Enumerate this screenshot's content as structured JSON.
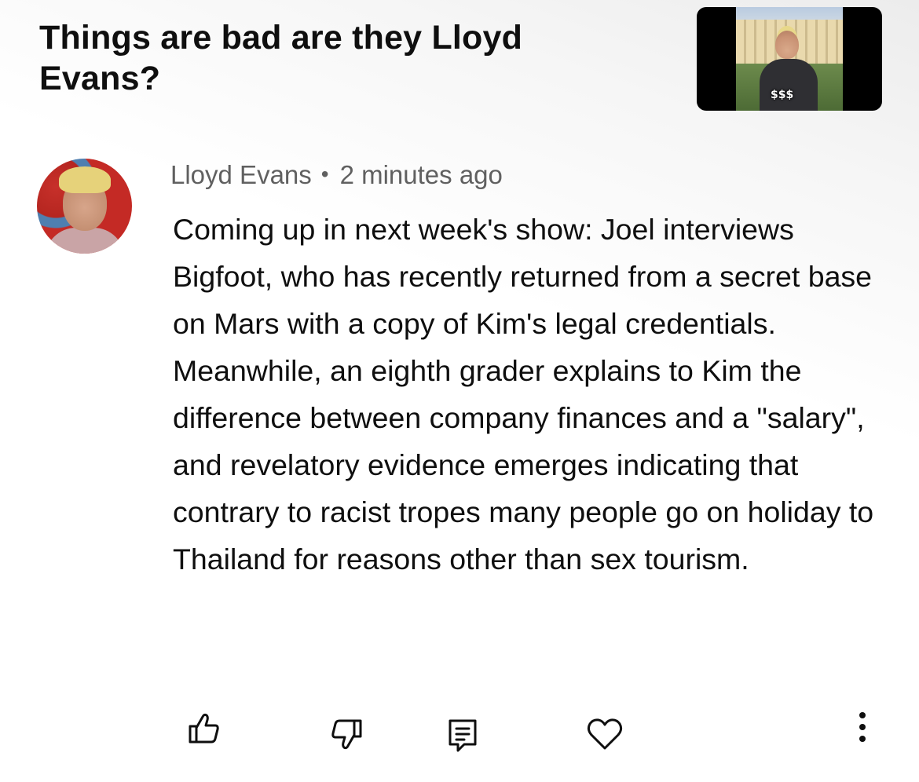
{
  "video": {
    "title": "Things are bad are they Lloyd Evans?",
    "thumbnail_overlay": "$$$"
  },
  "comment": {
    "author": "Lloyd Evans",
    "separator": "•",
    "timestamp": "2 minutes ago",
    "text": "Coming up in next week's show: Joel interviews Bigfoot, who has recently returned from a secret base on Mars with a copy of Kim's legal credentials. Meanwhile, an eighth grader explains to Kim the difference between company finances and a \"salary\", and revelatory evidence emerges indicating that contrary to racist tropes many people go on holiday to Thailand for reasons other than sex tourism."
  },
  "actions": {
    "like_icon": "thumbs-up-icon",
    "dislike_icon": "thumbs-down-icon",
    "reply_icon": "reply-comment-icon",
    "heart_icon": "heart-icon",
    "more_icon": "more-vertical-icon"
  },
  "colors": {
    "text_primary": "#0f0f0f",
    "text_secondary": "#606060",
    "background": "#ffffff"
  }
}
